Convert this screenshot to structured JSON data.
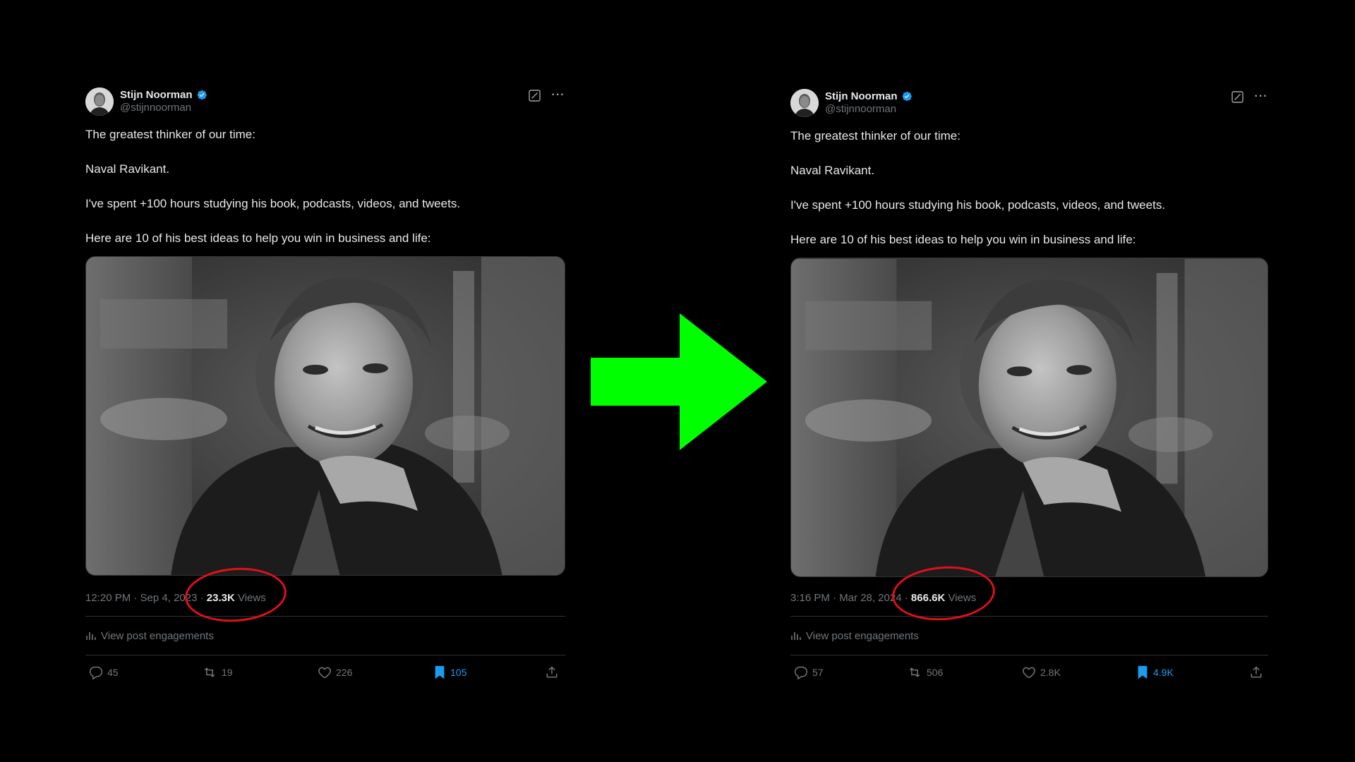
{
  "posts": [
    {
      "author_name": "Stijn Noorman",
      "author_handle": "@stijnnoorman",
      "text": [
        "The greatest thinker of our time:",
        "Naval Ravikant.",
        "I've spent +100 hours studying his book, podcasts, videos, and tweets.",
        "Here are 10 of his best ideas to help you win in business and life:"
      ],
      "timestamp": "12:20 PM · Sep 4, 2023 · ",
      "views_count": "23.3K",
      "views_label": " Views",
      "engagements_label": "View post engagements",
      "replies": "45",
      "reposts": "19",
      "likes": "226",
      "bookmarks": "105"
    },
    {
      "author_name": "Stijn Noorman",
      "author_handle": "@stijnnoorman",
      "text": [
        "The greatest thinker of our time:",
        "Naval Ravikant.",
        "I've spent +100 hours studying his book, podcasts, videos, and tweets.",
        "Here are 10 of his best ideas to help you win in business and life:"
      ],
      "timestamp": "3:16 PM · Mar 28, 2024 · ",
      "views_count": "866.6K",
      "views_label": " Views",
      "engagements_label": "View post engagements",
      "replies": "57",
      "reposts": "506",
      "likes": "2.8K",
      "bookmarks": "4.9K"
    }
  ],
  "icons": {
    "verified": "verified-badge-icon",
    "grok": "grok-icon",
    "more": "more-icon",
    "engagements": "analytics-icon",
    "reply": "reply-icon",
    "repost": "repost-icon",
    "like": "like-icon",
    "bookmark": "bookmark-icon",
    "share": "share-icon"
  },
  "colors": {
    "background": "#000000",
    "text": "#e7e9ea",
    "muted": "#71767b",
    "accent": "#1d9bf0",
    "arrow": "#00ff00",
    "highlight_circle": "#e0101a"
  }
}
